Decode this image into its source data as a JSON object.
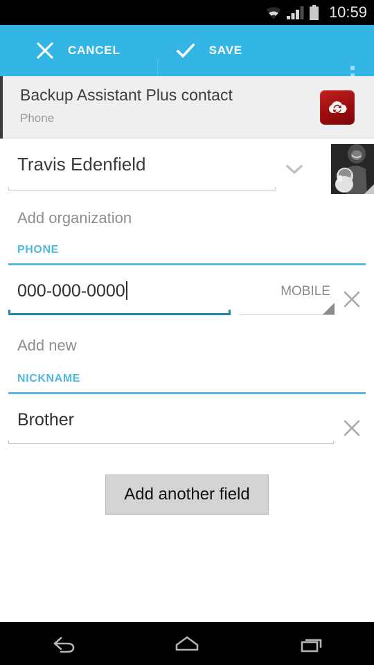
{
  "status_bar": {
    "time": "10:59",
    "icons": [
      "wifi-icon",
      "signal-icon",
      "battery-icon"
    ]
  },
  "action_bar": {
    "background_color": "#33b5e5",
    "cancel_label": "CANCEL",
    "cancel_icon": "close-icon",
    "save_label": "SAVE",
    "save_icon": "check-icon",
    "overflow_icon": "overflow-menu-icon"
  },
  "account_header": {
    "title": "Backup Assistant Plus contact",
    "subtitle": "Phone",
    "icon": "cloud-sync-icon",
    "icon_color": "#a81414",
    "background_color": "#efefef"
  },
  "contact": {
    "name": {
      "value": "Travis Edenfield",
      "expand_icon": "chevron-down-icon",
      "photo_icon": "contact-photo"
    },
    "organization": {
      "placeholder": "Add organization"
    },
    "phone_section": {
      "label": "PHONE",
      "accent_color": "#56b9e0",
      "value": "000-000-0000",
      "type": "MOBILE",
      "delete_icon": "close-icon",
      "add_new_label": "Add new",
      "focused": true,
      "focus_color": "#1f8cab"
    },
    "nickname_section": {
      "label": "NICKNAME",
      "accent_color": "#56b9e0",
      "value": "Brother",
      "delete_icon": "close-icon"
    }
  },
  "add_another_field": {
    "label": "Add another field"
  },
  "nav_bar": {
    "back_icon": "back-arrow-icon",
    "home_icon": "home-icon",
    "recents_icon": "recent-apps-icon"
  }
}
